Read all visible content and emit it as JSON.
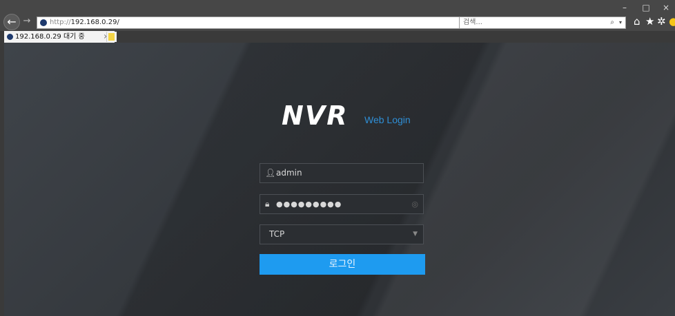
{
  "browser": {
    "url_protocol": "http://",
    "url_host": "192.168.0.29/",
    "search_placeholder": "검색...",
    "tab_title": "192.168.0.29 대기 중",
    "tab_close": "×",
    "addr_dropdown": "▾",
    "addr_refresh": "↻",
    "search_icon": "⌕",
    "search_dropdown": "▾",
    "win_min": "–",
    "win_max": "□",
    "win_close": "×",
    "back": "←",
    "forward": "→",
    "icons": [
      "home-icon",
      "star-icon",
      "gear-icon",
      "smiley-icon"
    ]
  },
  "login": {
    "logo": "NVR",
    "logo_subtitle": "Web Login",
    "username": "admin",
    "password_mask": "●●●●●●●●●",
    "protocol": "TCP",
    "login_button": "로그인"
  },
  "colors": {
    "accent": "#1e9bf0",
    "subtitle": "#2f8fd6",
    "background": "#3a3e43"
  }
}
